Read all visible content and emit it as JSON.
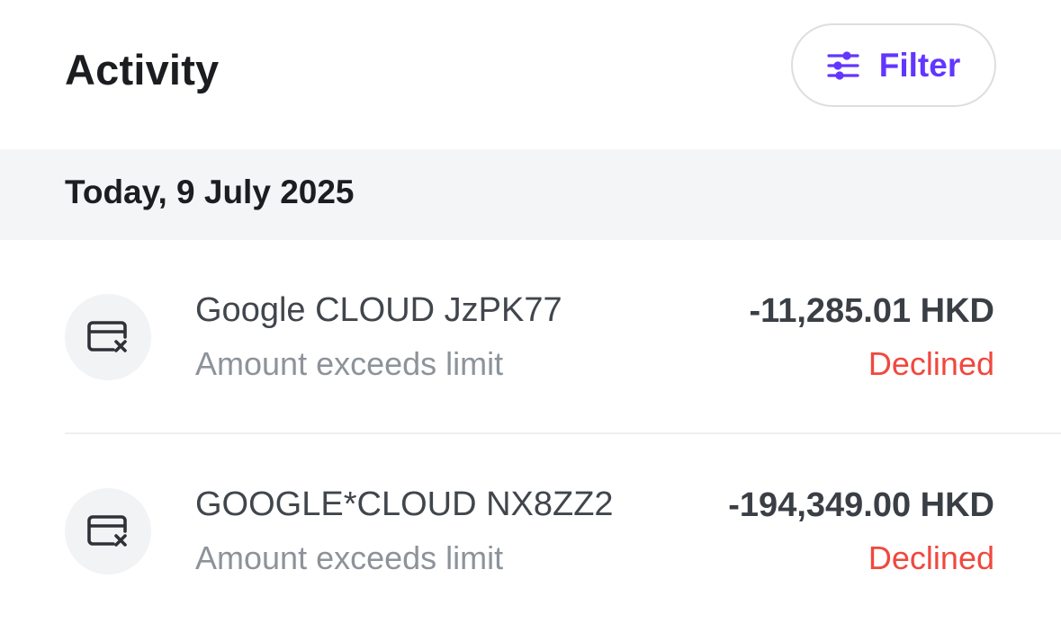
{
  "header": {
    "title": "Activity",
    "filter_label": "Filter"
  },
  "date_group": {
    "label": "Today, 9 July 2025"
  },
  "transactions": [
    {
      "merchant": "Google CLOUD JzPK77",
      "reason": "Amount exceeds limit",
      "amount": "-11,285.01 HKD",
      "status": "Declined",
      "icon": "card-declined-icon"
    },
    {
      "merchant": "GOOGLE*CLOUD NX8ZZ2",
      "reason": "Amount exceeds limit",
      "amount": "-194,349.00 HKD",
      "status": "Declined",
      "icon": "card-declined-icon"
    }
  ],
  "colors": {
    "accent": "#6236ff",
    "declined": "#f0483e",
    "band_background": "#f4f5f6"
  }
}
